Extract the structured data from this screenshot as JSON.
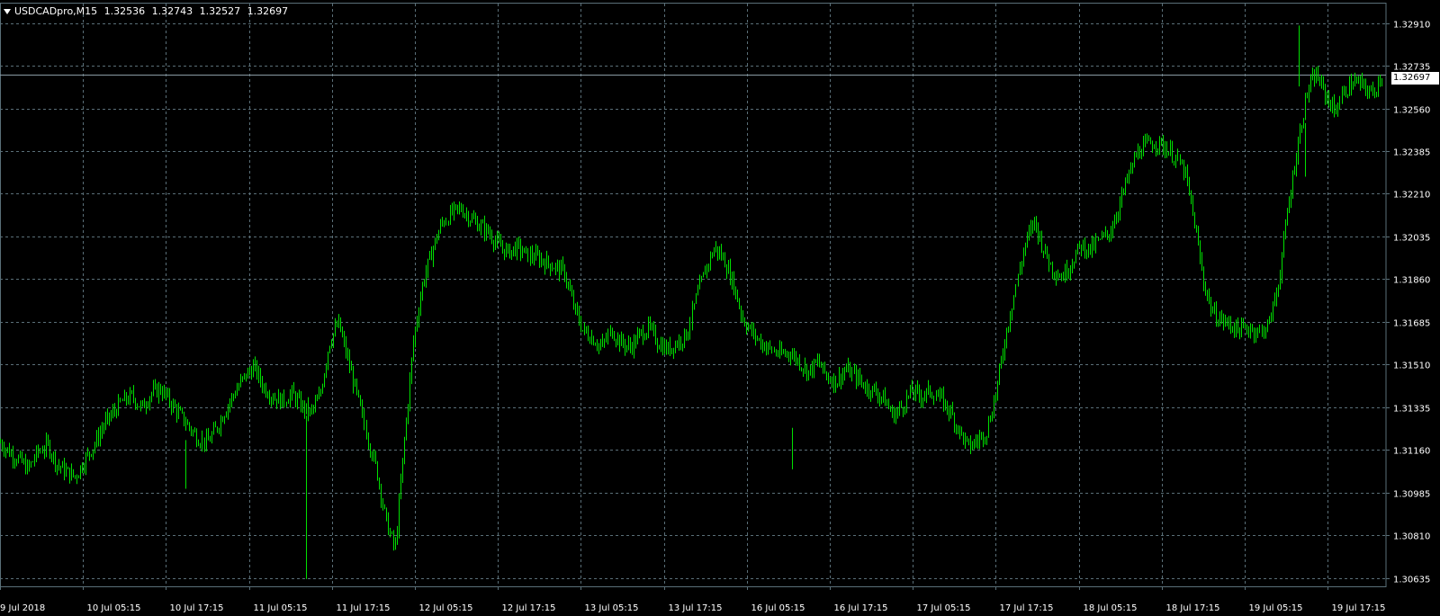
{
  "header": {
    "symbol": "USDCADpro,M15",
    "open": "1.32536",
    "high": "1.32743",
    "low": "1.32527",
    "close": "1.32697"
  },
  "current_price_label": "1.32697",
  "colors": {
    "background": "#000000",
    "grid": "#5a6f78",
    "candles": "#00e000",
    "axis_text": "#ffffff",
    "price_line": "#8a9aa3"
  },
  "chart_data": {
    "type": "line",
    "title": "",
    "xlabel": "",
    "ylabel": "",
    "y_ticks": [
      "1.32910",
      "1.32735",
      "1.32560",
      "1.32385",
      "1.32210",
      "1.32035",
      "1.31860",
      "1.31685",
      "1.31510",
      "1.31335",
      "1.31160",
      "1.30985",
      "1.30810",
      "1.30635"
    ],
    "x_ticks": [
      "9 Jul 2018",
      "10 Jul 05:15",
      "10 Jul 17:15",
      "11 Jul 05:15",
      "11 Jul 17:15",
      "12 Jul 05:15",
      "12 Jul 17:15",
      "13 Jul 05:15",
      "13 Jul 17:15",
      "16 Jul 05:15",
      "16 Jul 17:15",
      "17 Jul 05:15",
      "17 Jul 17:15",
      "18 Jul 05:15",
      "18 Jul 17:15",
      "19 Jul 05:15",
      "19 Jul 17:15"
    ],
    "ylim": [
      1.306,
      1.3299
    ],
    "grid": true,
    "series": [
      {
        "values": [
          1.3119,
          1.3115,
          1.3112,
          1.3108,
          1.3115,
          1.3118,
          1.311,
          1.3107,
          1.3105,
          1.3112,
          1.3118,
          1.3126,
          1.3131,
          1.3136,
          1.3138,
          1.3133,
          1.3139,
          1.3141,
          1.3136,
          1.3131,
          1.3126,
          1.3121,
          1.3119,
          1.3125,
          1.3133,
          1.314,
          1.3146,
          1.315,
          1.3142,
          1.3138,
          1.3136,
          1.3139,
          1.3134,
          1.3131,
          1.3138,
          1.316,
          1.3168,
          1.3153,
          1.3138,
          1.3122,
          1.3108,
          1.3087,
          1.3075,
          1.312,
          1.3162,
          1.3185,
          1.3198,
          1.3209,
          1.3213,
          1.3215,
          1.3211,
          1.3208,
          1.3205,
          1.32,
          1.3197,
          1.3199,
          1.3196,
          1.3195,
          1.3193,
          1.3191,
          1.3189,
          1.3175,
          1.3165,
          1.3162,
          1.3158,
          1.3165,
          1.316,
          1.3158,
          1.3163,
          1.3166,
          1.316,
          1.3157,
          1.316,
          1.3163,
          1.3178,
          1.319,
          1.3199,
          1.3194,
          1.3184,
          1.317,
          1.3164,
          1.316,
          1.3157,
          1.3155,
          1.3156,
          1.3152,
          1.3148,
          1.3152,
          1.3146,
          1.3144,
          1.3149,
          1.3146,
          1.3142,
          1.314,
          1.3137,
          1.313,
          1.3134,
          1.314,
          1.3138,
          1.314,
          1.3137,
          1.3132,
          1.3124,
          1.3117,
          1.312,
          1.3124,
          1.314,
          1.3163,
          1.3182,
          1.32,
          1.321,
          1.3198,
          1.319,
          1.3187,
          1.3193,
          1.32,
          1.3198,
          1.3202,
          1.3205,
          1.3216,
          1.3228,
          1.3238,
          1.3241,
          1.3242,
          1.324,
          1.3236,
          1.323,
          1.321,
          1.3185,
          1.3172,
          1.3169,
          1.3167,
          1.3165,
          1.3166,
          1.3164,
          1.3168,
          1.3185,
          1.3215,
          1.324,
          1.3262,
          1.327,
          1.3262,
          1.3255,
          1.3263,
          1.3267,
          1.3265,
          1.3262,
          1.327
        ]
      }
    ]
  }
}
